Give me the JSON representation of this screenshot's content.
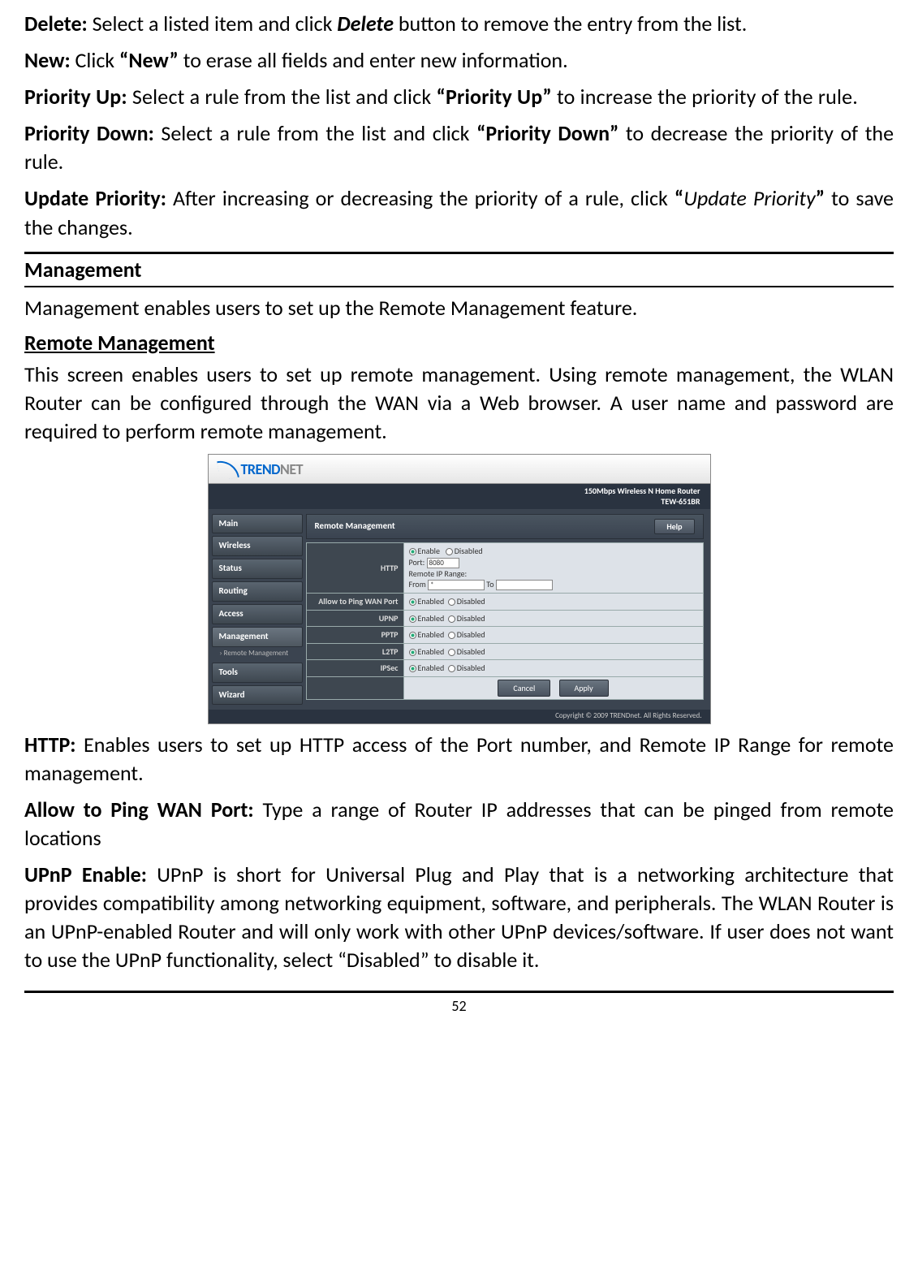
{
  "definitions": {
    "delete": {
      "label": "Delete:",
      "text_pre": " Select a listed item and click ",
      "emph": "Delete",
      "text_post": " button to remove the entry from the list."
    },
    "new": {
      "label": "New:",
      "text_pre": " Click ",
      "emph": "“New”",
      "text_post": " to erase all fields and enter new information."
    },
    "priority_up": {
      "label": "Priority Up:",
      "text_pre": " Select a rule from the list and click ",
      "emph": "“Priority Up”",
      "text_post": " to increase the priority of the rule."
    },
    "priority_down": {
      "label": "Priority Down:",
      "text_pre": " Select a rule from the list and click ",
      "emph": "“Priority Down”",
      "text_post": " to decrease the priority of the rule."
    },
    "update_priority": {
      "label": "Update Priority:",
      "text_pre": " After increasing or decreasing the priority of a rule, click ",
      "emph_open": "“",
      "emph_mid": "Update Priority",
      "emph_close": "”",
      "text_post": " to save the changes."
    }
  },
  "section": {
    "heading": "Management",
    "intro": "Management enables users to set up the Remote Management feature.",
    "subheading": "Remote Management",
    "description": "This screen enables users to set up remote management. Using remote management, the WLAN Router can be configured through the WAN via a Web browser. A user name and password are required to perform remote management."
  },
  "router_ui": {
    "brand_main": "TREND",
    "brand_sub": "NET",
    "model_line1": "150Mbps Wireless N Home Router",
    "model_line2": "TEW-651BR",
    "nav": [
      "Main",
      "Wireless",
      "Status",
      "Routing",
      "Access",
      "Management",
      "Tools",
      "Wizard"
    ],
    "nav_sub": "› Remote Management",
    "panel_title": "Remote Management",
    "help": "Help",
    "rows": {
      "http": {
        "label": "HTTP",
        "enable": "Enable",
        "disabled": "Disabled",
        "port_label": "Port:",
        "port_value": "8080",
        "range_label": "Remote IP Range:",
        "from": "From",
        "from_value": "*",
        "to": "To"
      },
      "ping": {
        "label": "Allow to Ping WAN Port",
        "enabled": "Enabled",
        "disabled": "Disabled"
      },
      "upnp": {
        "label": "UPNP",
        "enabled": "Enabled",
        "disabled": "Disabled"
      },
      "pptp": {
        "label": "PPTP",
        "enabled": "Enabled",
        "disabled": "Disabled"
      },
      "l2tp": {
        "label": "L2TP",
        "enabled": "Enabled",
        "disabled": "Disabled"
      },
      "ipsec": {
        "label": "IPSec",
        "enabled": "Enabled",
        "disabled": "Disabled"
      }
    },
    "buttons": {
      "cancel": "Cancel",
      "apply": "Apply"
    },
    "copyright": "Copyright © 2009 TRENDnet. All Rights Reserved."
  },
  "post_defs": {
    "http": {
      "label": "HTTP:",
      "text": " Enables users to set up HTTP access of the Port number, and Remote IP Range for remote management."
    },
    "ping": {
      "label": "Allow to Ping WAN Port:",
      "text": " Type a range of Router IP addresses that can be pinged from remote locations"
    },
    "upnp": {
      "label": "UPnP Enable:",
      "text": " UPnP is short for Universal Plug and Play that is a networking architecture that provides compatibility among networking equipment, software, and peripherals. The WLAN Router is an UPnP-enabled Router and will only work with other UPnP devices/software. If user does not want to use the UPnP functionality, select “Disabled” to disable it."
    }
  },
  "page_number": "52"
}
